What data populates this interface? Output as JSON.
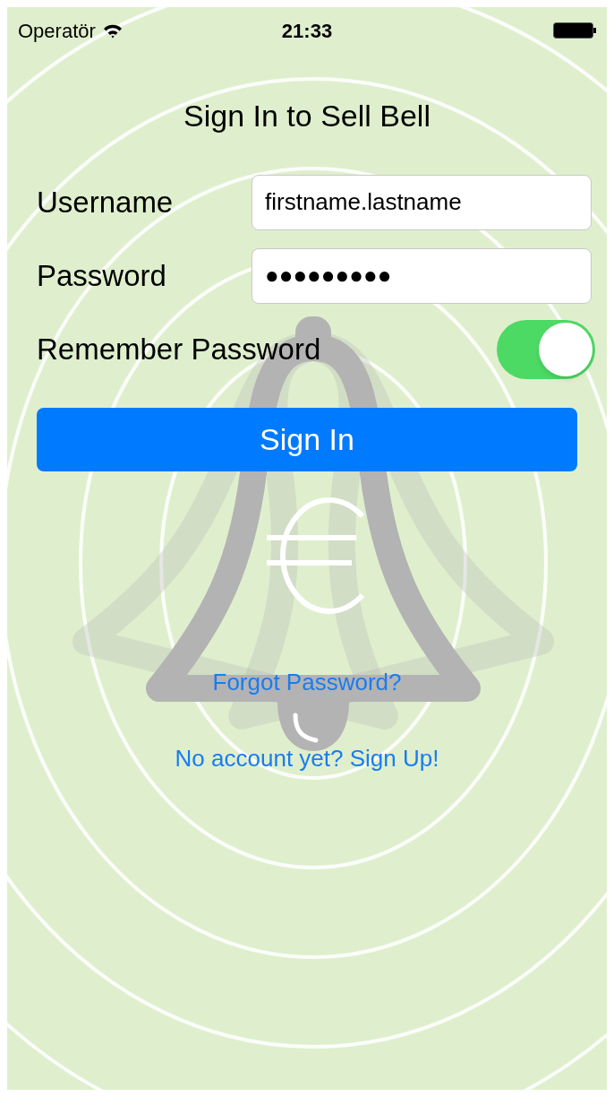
{
  "status_bar": {
    "carrier": "Operatör",
    "time": "21:33"
  },
  "title": "Sign In to Sell Bell",
  "fields": [
    {
      "label": "Username",
      "value": "firstname.lastname"
    },
    {
      "label": "Password",
      "value": "●●●●●●●●●"
    }
  ],
  "remember": {
    "label": "Remember Password",
    "on": true
  },
  "sign_in_button": "Sign In",
  "links": [
    "Forgot Password?",
    "No account yet? Sign Up!"
  ]
}
